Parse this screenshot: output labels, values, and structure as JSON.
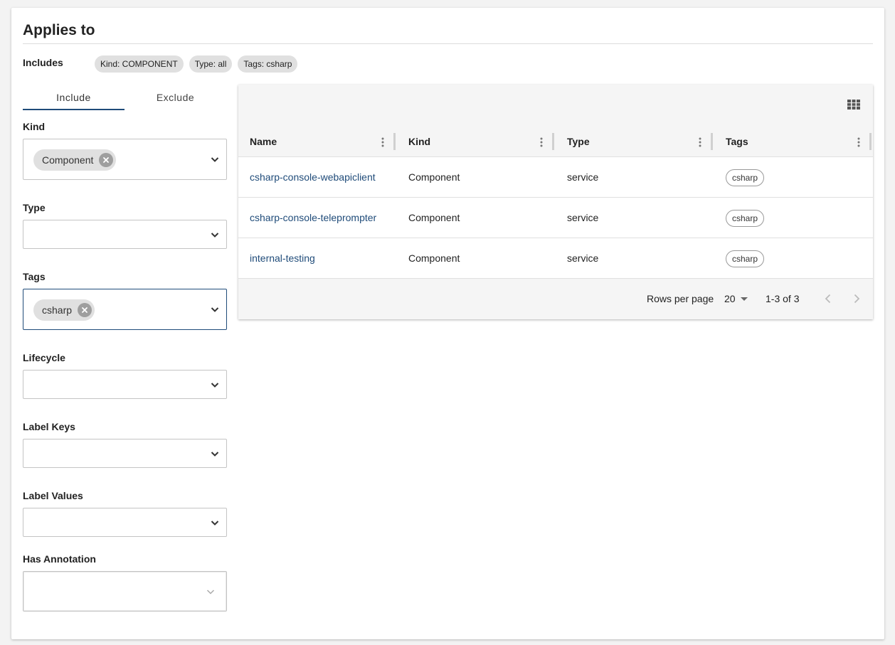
{
  "card": {
    "title": "Applies to"
  },
  "includes": {
    "label": "Includes",
    "chips": [
      "Kind: COMPONENT",
      "Type: all",
      "Tags: csharp"
    ]
  },
  "tabs": [
    {
      "label": "Include",
      "active": true
    },
    {
      "label": "Exclude",
      "active": false
    }
  ],
  "filters": {
    "kind": {
      "label": "Kind",
      "chip": "Component"
    },
    "type": {
      "label": "Type"
    },
    "tags": {
      "label": "Tags",
      "chip": "csharp"
    },
    "lifecycle": {
      "label": "Lifecycle"
    },
    "label_keys": {
      "label": "Label Keys"
    },
    "label_values": {
      "label": "Label Values"
    },
    "has_annotation": {
      "label": "Has Annotation"
    }
  },
  "table": {
    "columns": [
      "Name",
      "Kind",
      "Type",
      "Tags"
    ],
    "rows": [
      {
        "name": "csharp-console-webapiclient",
        "kind": "Component",
        "type": "service",
        "tag": "csharp"
      },
      {
        "name": "csharp-console-teleprompter",
        "kind": "Component",
        "type": "service",
        "tag": "csharp"
      },
      {
        "name": "internal-testing",
        "kind": "Component",
        "type": "service",
        "tag": "csharp"
      }
    ],
    "pagination": {
      "rows_per_page_label": "Rows per page",
      "rows_per_page": "20",
      "range": "1-3 of 3"
    }
  },
  "colors": {
    "accent": "#1f4b79",
    "chip": "#e0e0e0"
  }
}
